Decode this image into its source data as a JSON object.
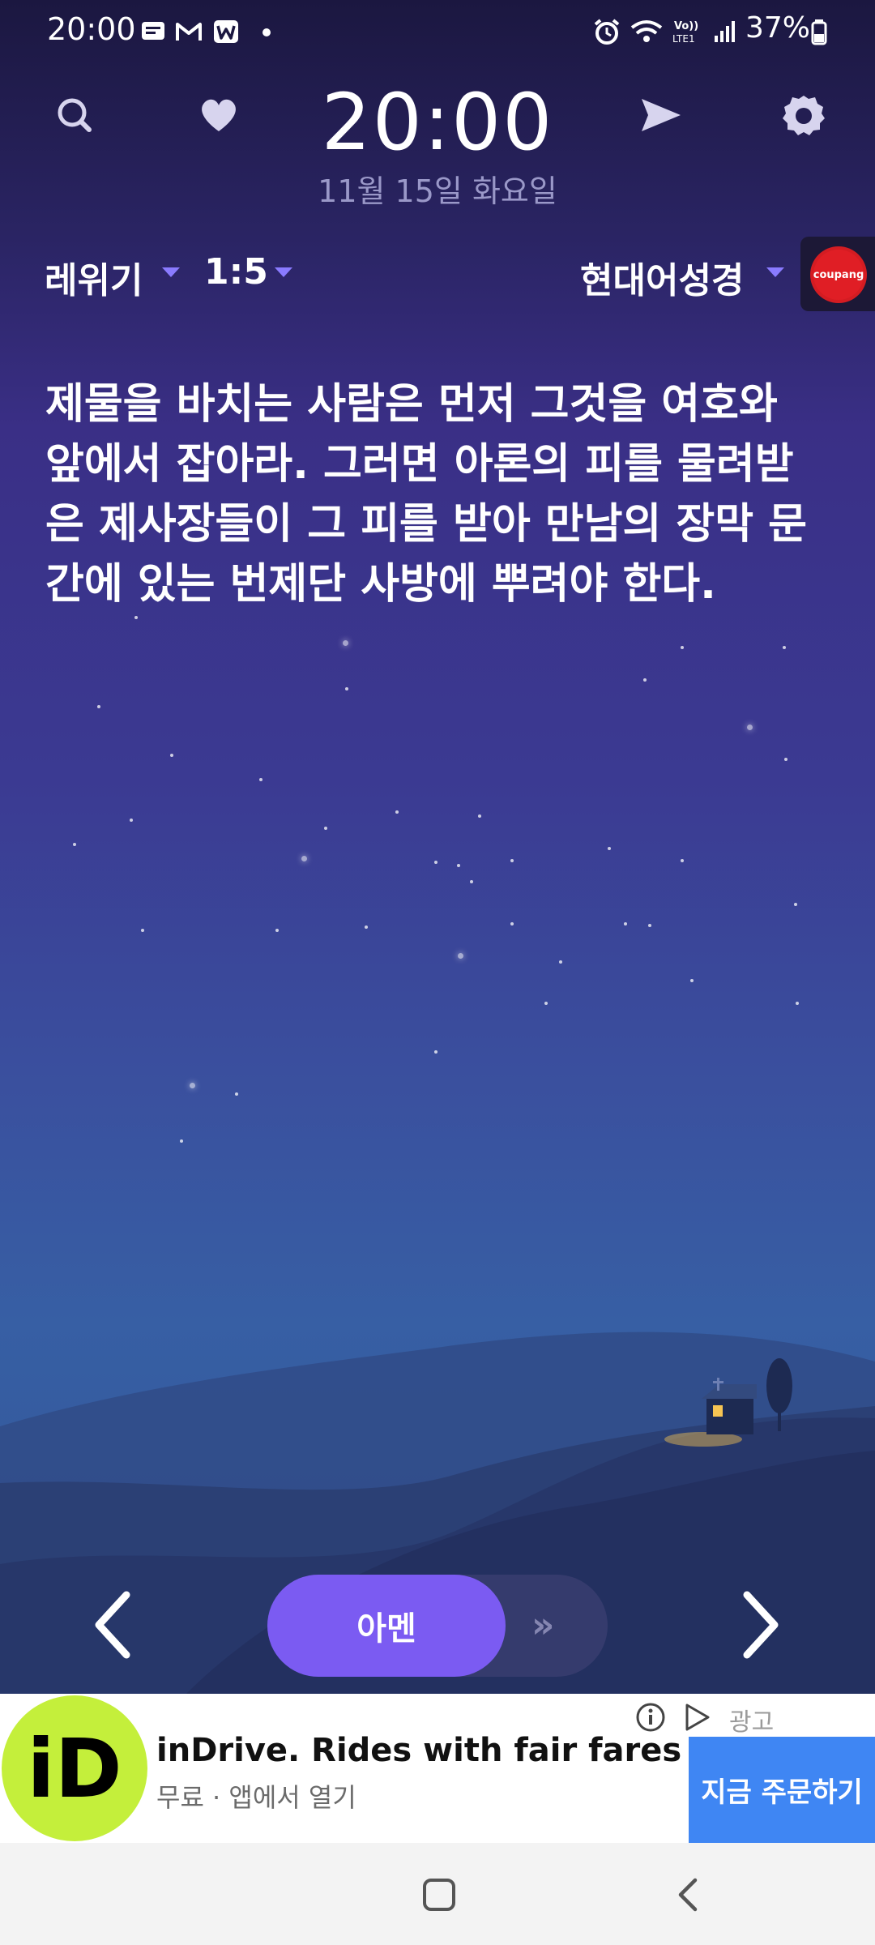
{
  "status_bar": {
    "time": "20:00",
    "battery": "37%",
    "network": "VoLTE1"
  },
  "header": {
    "clock": "20:00",
    "date": "11월 15일 화요일"
  },
  "selector": {
    "book": "레위기",
    "chapter_verse": "1:5",
    "translation": "현대어성경",
    "partner_badge": "coupang"
  },
  "verse": {
    "text": "제물을 바치는 사람은 먼저 그것을 여호와 앞에서 잡아라. 그러면 아론의 피를 물려받은 제사장들이 그 피를 받아 만남의 장막 문간에 있는 번제단 사방에 뿌려야 한다."
  },
  "controls": {
    "amen_label": "아멘",
    "swipe_hint": "»"
  },
  "ad": {
    "logo_text": "iD",
    "title": "inDrive. Rides with fair fares",
    "subtitle": "무료 · 앱에서 열기",
    "label": "광고",
    "cta": "지금 주문하기"
  },
  "colors": {
    "accent": "#7b5bf2",
    "caret": "#8a7bff",
    "ad_cta": "#3f86f3",
    "ad_logo_bg": "#c4ef3b",
    "coupang_red": "#e01e25"
  },
  "icons": {
    "header_left": [
      "search-icon",
      "heart-icon"
    ],
    "header_right": [
      "send-icon",
      "settings-icon"
    ],
    "status_left": [
      "message-icon",
      "gmail-icon",
      "w-icon",
      "dot-icon"
    ],
    "status_right": [
      "alarm-icon",
      "wifi-icon",
      "volte-icon",
      "signal-icon",
      "battery-icon"
    ]
  }
}
